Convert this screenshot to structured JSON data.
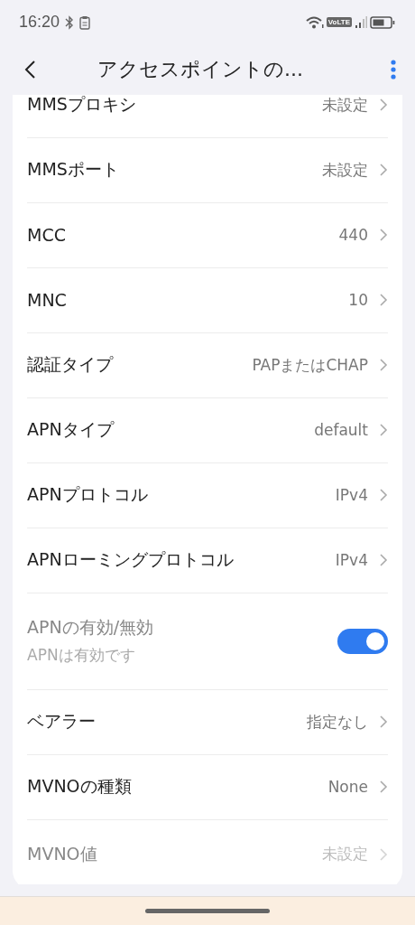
{
  "status_bar": {
    "time": "16:20",
    "network_badge": "VoLTE"
  },
  "header": {
    "title": "アクセスポイントの..."
  },
  "settings": [
    {
      "kind": "link",
      "label": "MMSプロキシ",
      "value": "未設定",
      "disabled": false
    },
    {
      "kind": "link",
      "label": "MMSポート",
      "value": "未設定",
      "disabled": false
    },
    {
      "kind": "link",
      "label": "MCC",
      "value": "440",
      "disabled": false
    },
    {
      "kind": "link",
      "label": "MNC",
      "value": "10",
      "disabled": false
    },
    {
      "kind": "link",
      "label": "認証タイプ",
      "value": "PAPまたはCHAP",
      "disabled": false
    },
    {
      "kind": "link",
      "label": "APNタイプ",
      "value": "default",
      "disabled": false
    },
    {
      "kind": "link",
      "label": "APNプロトコル",
      "value": "IPv4",
      "disabled": false
    },
    {
      "kind": "link",
      "label": "APNローミングプロトコル",
      "value": "IPv4",
      "disabled": false
    },
    {
      "kind": "toggle",
      "label": "APNの有効/無効",
      "summary": "APNは有効です",
      "on": true,
      "disabled": true
    },
    {
      "kind": "link",
      "label": "ベアラー",
      "value": "指定なし",
      "disabled": false
    },
    {
      "kind": "link",
      "label": "MVNOの種類",
      "value": "None",
      "disabled": false
    },
    {
      "kind": "link",
      "label": "MVNO値",
      "value": "未設定",
      "disabled": true
    }
  ]
}
